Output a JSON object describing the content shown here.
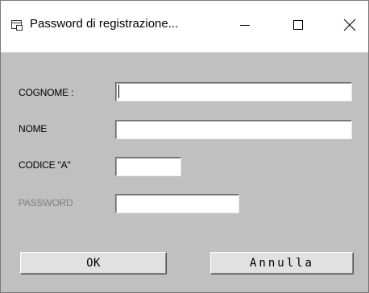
{
  "window": {
    "title": "Password di registrazione...",
    "app_icon": "key-dialog-icon",
    "controls": {
      "minimize": "minimize-icon",
      "maximize": "maximize-icon",
      "close": "close-icon"
    }
  },
  "form": {
    "cognome_label": "COGNOME :",
    "cognome_value": "",
    "nome_label": "NOME",
    "nome_value": "",
    "codice_label": "CODICE \"A\"",
    "codice_value": "",
    "password_label": "PASSWORD",
    "password_value": ""
  },
  "buttons": {
    "ok_label": "OK",
    "cancel_label": "Annulla"
  },
  "colors": {
    "dialog_background": "#c0c0c0",
    "disabled_text": "#7f7f7f"
  }
}
